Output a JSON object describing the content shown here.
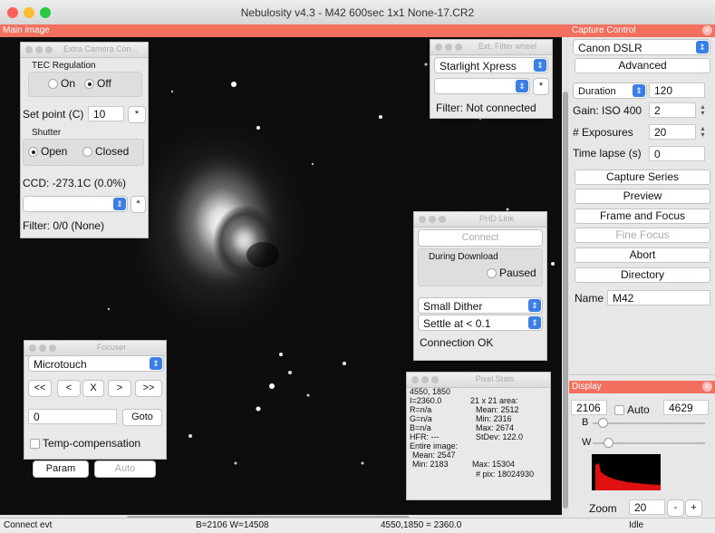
{
  "window": {
    "title": "Nebulosity v4.3 - M42 600sec 1x1 None-17.CR2"
  },
  "main_image": {
    "header": "Main image"
  },
  "extra_camera": {
    "title": "Extra Camera Con...",
    "tec_label": "TEC Regulation",
    "tec_on": "On",
    "tec_off": "Off",
    "setpoint_label": "Set point (C)",
    "setpoint_value": "10",
    "setpoint_btn": "*",
    "shutter_label": "Shutter",
    "shutter_open": "Open",
    "shutter_closed": "Closed",
    "ccd_text": "CCD: -273.1C (0.0%)",
    "filter_select_btn": "*",
    "filter_text": "Filter: 0/0 (None)"
  },
  "filter_wheel": {
    "title": "Ext. Filter wheel",
    "device": "Starlight Xpress",
    "btn": "*",
    "status": "Filter: Not connected"
  },
  "phd_link": {
    "title": "PHD Link",
    "connect": "Connect",
    "during_download": "During Download",
    "paused": "Paused",
    "dither": "Small Dither",
    "settle": "Settle at < 0.1",
    "status": "Connection OK"
  },
  "focuser": {
    "title": "Focuser",
    "device": "Microtouch",
    "moves": [
      "<<",
      "<",
      "X",
      ">",
      ">>"
    ],
    "position": "0",
    "goto": "Goto",
    "temp_comp": "Temp-compensation",
    "param": "Param",
    "auto": "Auto"
  },
  "pixel_stats": {
    "title": "Pixel Stats",
    "coords": "4550, 1850",
    "i_val": "I=2360.0",
    "r_val": "R=n/a",
    "g_val": "G=n/a",
    "b_val": "B=n/a",
    "hfr": "HFR: ---",
    "area": "21 x 21 area:",
    "mean": "Mean: 2512",
    "min": "Min: 2316",
    "max": "Max: 2674",
    "stdev": "StDev: 122.0",
    "entire": "Entire image:",
    "e_mean": "Mean: 2547",
    "e_min": "Min: 2183",
    "e_max": "Max: 15304",
    "e_pix": "# pix: 18024930"
  },
  "capture": {
    "header": "Capture Control",
    "camera": "Canon DSLR",
    "advanced": "Advanced",
    "duration_label": "Duration",
    "duration_value": "120",
    "gain_label": "Gain: ISO 400",
    "gain_value": "2",
    "exposures_label": "# Exposures",
    "exposures_value": "20",
    "timelapse_label": "Time lapse (s)",
    "timelapse_value": "0",
    "buttons": [
      "Capture Series",
      "Preview",
      "Frame and Focus",
      "Fine Focus",
      "Abort",
      "Directory"
    ],
    "name_label": "Name",
    "name_value": "M42"
  },
  "display": {
    "header": "Display",
    "black_value": "2106",
    "auto_label": "Auto",
    "white_value": "4629",
    "b_label": "B",
    "w_label": "W",
    "black_slider_level": 0.05,
    "white_slider_level": 0.1,
    "zoom_label": "Zoom",
    "zoom_value": "20",
    "zoom_minus": "-",
    "zoom_plus": "+"
  },
  "status": {
    "left": "Connect evt",
    "bw": "B=2106 W=14508",
    "pixel": "4550,1850 = 2360.0",
    "state": "Idle"
  },
  "colors": {
    "accent_header": "#f4705e",
    "select_blue": "#3a7ee8",
    "histogram_red": "#e01010"
  }
}
